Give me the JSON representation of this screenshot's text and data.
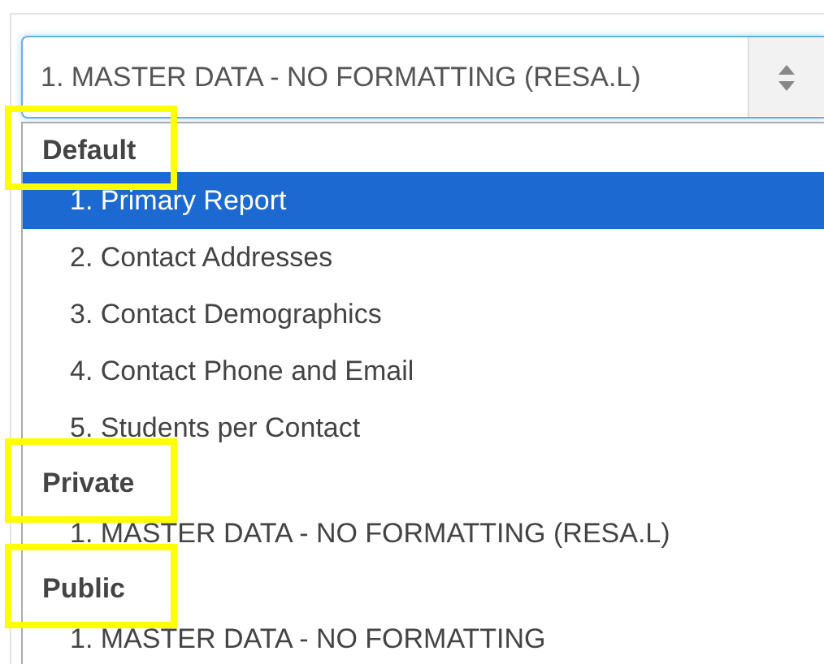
{
  "select": {
    "value": "1. MASTER DATA - NO FORMATTING (RESA.L)"
  },
  "groups": [
    {
      "label": "Default",
      "highlighted": true,
      "options": [
        {
          "label": "1. Primary Report",
          "selected": true
        },
        {
          "label": "2. Contact Addresses",
          "selected": false
        },
        {
          "label": "3. Contact Demographics",
          "selected": false
        },
        {
          "label": "4. Contact Phone and Email",
          "selected": false
        },
        {
          "label": "5. Students per Contact",
          "selected": false
        }
      ]
    },
    {
      "label": "Private",
      "highlighted": true,
      "options": [
        {
          "label": "1. MASTER DATA - NO FORMATTING (RESA.L)",
          "selected": false
        }
      ]
    },
    {
      "label": "Public",
      "highlighted": true,
      "options": [
        {
          "label": "1. MASTER DATA - NO FORMATTING",
          "selected": false
        }
      ]
    }
  ]
}
